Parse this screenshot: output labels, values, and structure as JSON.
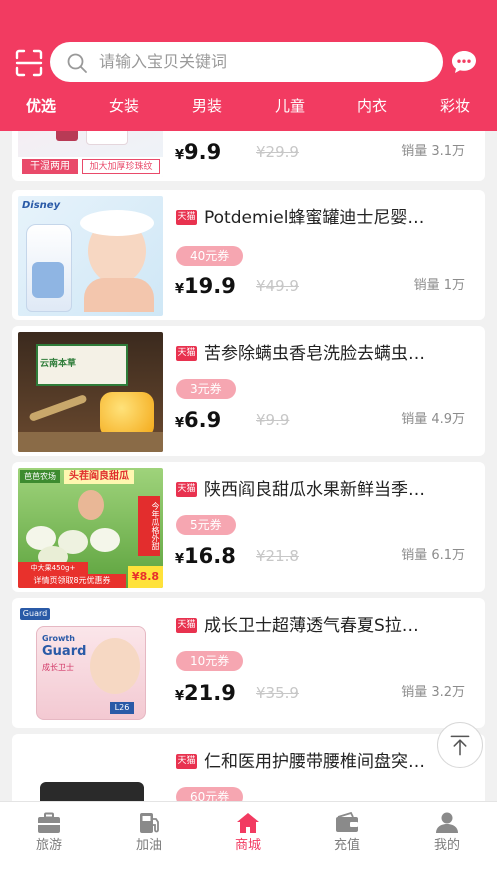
{
  "search": {
    "placeholder": "请输入宝贝关键词"
  },
  "tabs": [
    {
      "label": "优选",
      "active": true
    },
    {
      "label": "女装"
    },
    {
      "label": "男装"
    },
    {
      "label": "儿童"
    },
    {
      "label": "内衣"
    },
    {
      "label": "彩妆"
    }
  ],
  "products": [
    {
      "title": "",
      "price": "9.9",
      "original": "¥29.9",
      "sales": "销量 3.1万",
      "thumb_text": [
        "干湿两用",
        "加大加厚珍珠纹"
      ]
    },
    {
      "title": "Potdemiel蜂蜜罐迪士尼婴…",
      "tmall": "天猫",
      "coupon": "40元券",
      "price": "19.9",
      "original": "¥49.9",
      "sales": "销量 1万",
      "thumb_text": [
        "Disney"
      ]
    },
    {
      "title": "苦参除螨虫香皂洗脸去螨虫…",
      "tmall": "天猫",
      "coupon": "3元券",
      "price": "6.9",
      "original": "¥9.9",
      "sales": "销量 4.9万",
      "thumb_text": [
        "云南本草"
      ]
    },
    {
      "title": "陕西阎良甜瓜水果新鲜当季…",
      "tmall": "天猫",
      "coupon": "5元券",
      "price": "16.8",
      "original": "¥21.8",
      "sales": "销量 6.1万",
      "thumb_text": [
        "芭芭农场",
        "头茬阎良甜瓜",
        "今年瓜格外甜",
        "中大果450g+",
        "详情页领取8元优惠券",
        "¥8.8"
      ]
    },
    {
      "title": "成长卫士超薄透气春夏S拉…",
      "tmall": "天猫",
      "coupon": "10元券",
      "price": "21.9",
      "original": "¥35.9",
      "sales": "销量 3.2万",
      "thumb_text": [
        "Growth",
        "Guard",
        "成长卫士",
        "L26"
      ]
    },
    {
      "title": "仁和医用护腰带腰椎间盘突…",
      "tmall": "天猫",
      "coupon": "60元券",
      "price": "",
      "original": "",
      "sales": ""
    }
  ],
  "currency": "¥",
  "tabbar": [
    {
      "label": "旅游",
      "icon": "suitcase-icon"
    },
    {
      "label": "加油",
      "icon": "fuel-pump-icon"
    },
    {
      "label": "商城",
      "icon": "home-icon",
      "active": true
    },
    {
      "label": "充值",
      "icon": "wallet-icon"
    },
    {
      "label": "我的",
      "icon": "person-icon"
    }
  ],
  "colors": {
    "brand": "#f23b61",
    "coupon": "#f6a6b1",
    "tmall": "#e8324f"
  }
}
